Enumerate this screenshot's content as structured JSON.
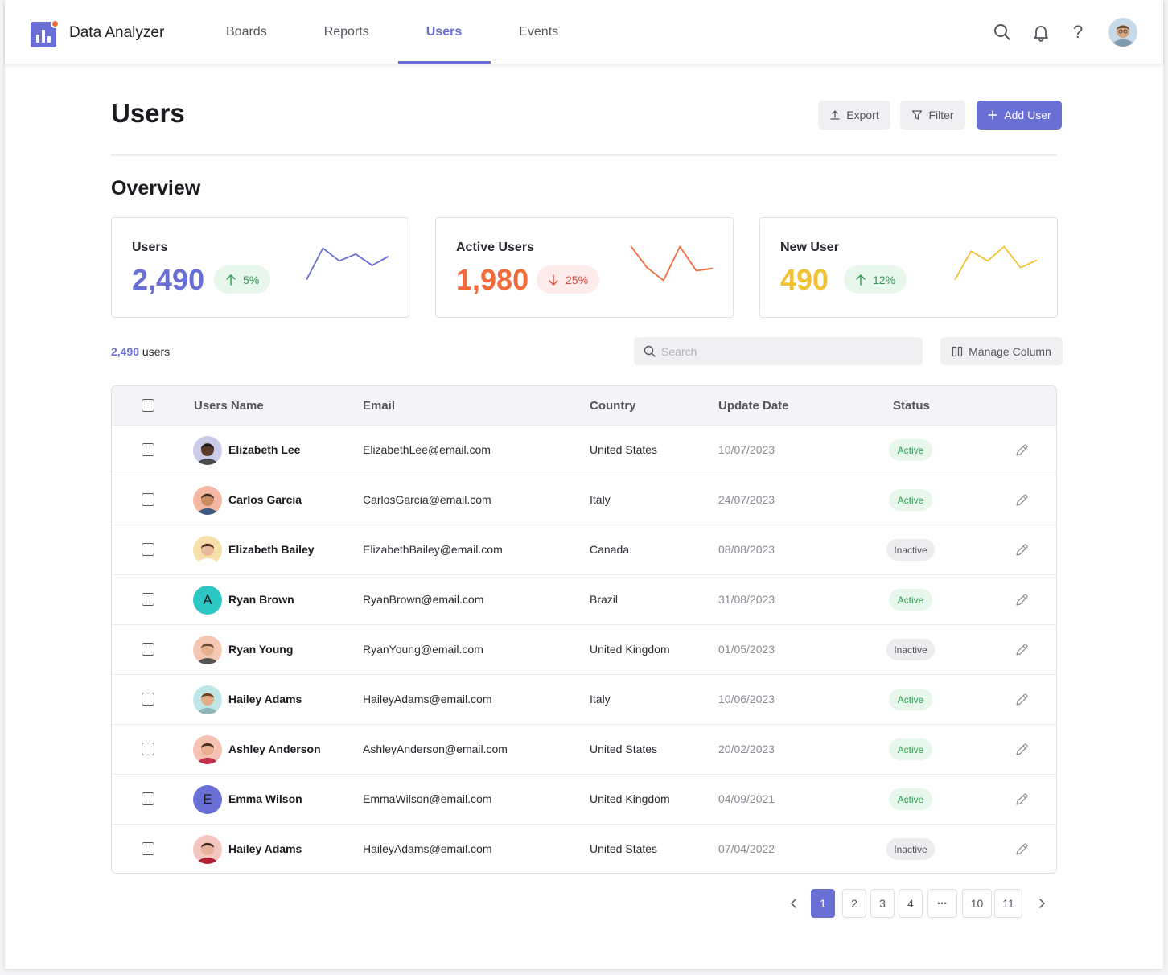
{
  "app": {
    "brand": "Data Analyzer"
  },
  "nav": {
    "items": [
      "Boards",
      "Reports",
      "Users",
      "Events"
    ],
    "active": "Users"
  },
  "header": {
    "help_label": "?"
  },
  "page": {
    "title": "Users",
    "actions": {
      "export_label": "Export",
      "filter_label": "Filter",
      "add_user_label": "Add User"
    }
  },
  "overview": {
    "title": "Overview",
    "cards": [
      {
        "label": "Users",
        "value": "2,490",
        "trend": "5%",
        "direction": "up",
        "color": "#6a6fd6",
        "spark": [
          10,
          52,
          35,
          44,
          29,
          41
        ]
      },
      {
        "label": "Active Users",
        "value": "1,980",
        "trend": "25%",
        "direction": "down",
        "color": "#f26b3a",
        "spark": [
          55,
          26,
          9,
          54,
          22,
          25
        ]
      },
      {
        "label": "New User",
        "value": "490",
        "trend": "12%",
        "direction": "up",
        "color": "#f1c232",
        "spark": [
          10,
          48,
          35,
          54,
          26,
          36
        ]
      }
    ]
  },
  "toolbar": {
    "count_number": "2,490",
    "count_suffix": " users",
    "search_placeholder": "Search",
    "manage_column_label": "Manage Column"
  },
  "table": {
    "headers": {
      "name": "Users Name",
      "email": "Email",
      "country": "Country",
      "update_date": "Update Date",
      "status": "Status"
    },
    "rows": [
      {
        "name": "Elizabeth Lee",
        "email": "ElizabethLee@email.com",
        "country": "United States",
        "date": "10/07/2023",
        "status": "Active",
        "avatar": "photo",
        "avatar_bg": "#c9cbe8",
        "skin": "#5a3a28",
        "hair": "#1a1a1a",
        "shirt": "#4a4a4a"
      },
      {
        "name": "Carlos Garcia",
        "email": "CarlosGarcia@email.com",
        "country": "Italy",
        "date": "24/07/2023",
        "status": "Active",
        "avatar": "photo",
        "avatar_bg": "#f4b7a3",
        "skin": "#c98a62",
        "hair": "#3a2a20",
        "shirt": "#3d5a80"
      },
      {
        "name": "Elizabeth Bailey",
        "email": "ElizabethBailey@email.com",
        "country": "Canada",
        "date": "08/08/2023",
        "status": "Inactive",
        "avatar": "photo",
        "avatar_bg": "#f6dfa8",
        "skin": "#e8b99a",
        "hair": "#4a2a1a",
        "shirt": "#ffffff"
      },
      {
        "name": "Ryan Brown",
        "email": "RyanBrown@email.com",
        "country": "Brazil",
        "date": "31/08/2023",
        "status": "Active",
        "avatar": "initial",
        "initial": "A",
        "avatar_bg": "#2cc7c3"
      },
      {
        "name": "Ryan Young",
        "email": "RyanYoung@email.com",
        "country": "United Kingdom",
        "date": "01/05/2023",
        "status": "Inactive",
        "avatar": "photo",
        "avatar_bg": "#f4c7b3",
        "skin": "#e6b08e",
        "hair": "#6a4a30",
        "shirt": "#555555"
      },
      {
        "name": "Hailey Adams",
        "email": "HaileyAdams@email.com",
        "country": "Italy",
        "date": "10/06/2023",
        "status": "Active",
        "avatar": "photo",
        "avatar_bg": "#bfe6e6",
        "skin": "#e2ad88",
        "hair": "#6a4328",
        "shirt": "#8fb6b6"
      },
      {
        "name": "Ashley Anderson",
        "email": "AshleyAnderson@email.com",
        "country": "United States",
        "date": "20/02/2023",
        "status": "Active",
        "avatar": "photo",
        "avatar_bg": "#f5c1b3",
        "skin": "#e8b08e",
        "hair": "#4a2e20",
        "shirt": "#c0304a"
      },
      {
        "name": "Emma Wilson",
        "email": "EmmaWilson@email.com",
        "country": "United Kingdom",
        "date": "04/09/2021",
        "status": "Active",
        "avatar": "initial",
        "initial": "E",
        "avatar_bg": "#6a6fd6"
      },
      {
        "name": "Hailey Adams",
        "email": "HaileyAdams@email.com",
        "country": "United States",
        "date": "07/04/2022",
        "status": "Inactive",
        "avatar": "photo",
        "avatar_bg": "#f3c6c0",
        "skin": "#e6b29a",
        "hair": "#3a2218",
        "shirt": "#b02030"
      }
    ]
  },
  "pagination": {
    "pages": [
      "1",
      "2",
      "3",
      "4",
      "•••",
      "10",
      "11"
    ],
    "current": "1"
  },
  "colors": {
    "accent": "#6a6fd6",
    "success": "#2e9b4e",
    "danger": "#e0493a",
    "warning": "#f1c232",
    "orange": "#f26b3a"
  }
}
